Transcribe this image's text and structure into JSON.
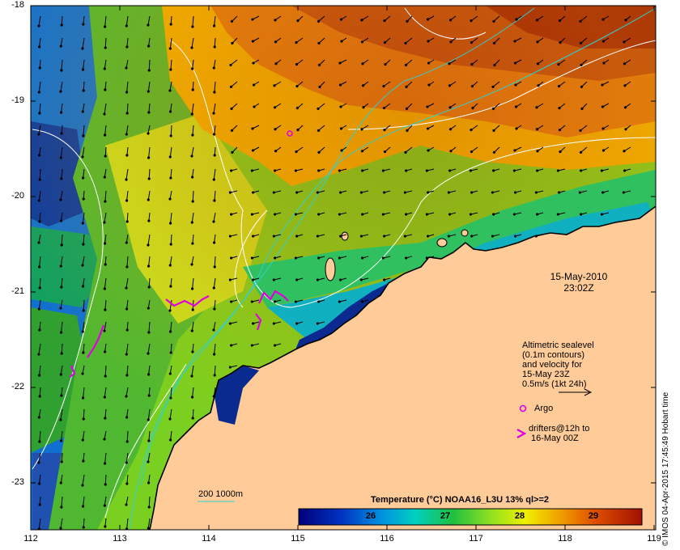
{
  "map": {
    "lon_range": [
      112,
      119
    ],
    "lat_range": [
      -23.5,
      -18
    ],
    "x_ticks": [
      "112",
      "113",
      "114",
      "115",
      "116",
      "117",
      "118",
      "119"
    ],
    "y_ticks": [
      "-18",
      "-19",
      "-20",
      "-21",
      "-22",
      "-23"
    ],
    "land_color": "#ffcc99",
    "ocean_warm_color": "#b03000",
    "ocean_cool_color": "#1020a0"
  },
  "annotations": {
    "date": "15-May-2010",
    "time": "23:02Z",
    "altimetric_lines": [
      "Altimetric sealevel",
      "(0.1m contours)",
      "and velocity for",
      "15-May 23Z",
      "0.5m/s (1kt 24h)"
    ],
    "argo_label": "Argo",
    "drifters_line1": "drifters@12h to",
    "drifters_line2": "16-May 00Z",
    "bathy_label": "200  1000m"
  },
  "colorbar": {
    "title": "Temperature (°C) NOAA16_L3U 13% ql>=2",
    "ticks": [
      "26",
      "27",
      "28",
      "29"
    ],
    "range": [
      25,
      29.5
    ]
  },
  "credit": "© IMOS 04-Apr-2015 17:45:49 Hobart time"
}
